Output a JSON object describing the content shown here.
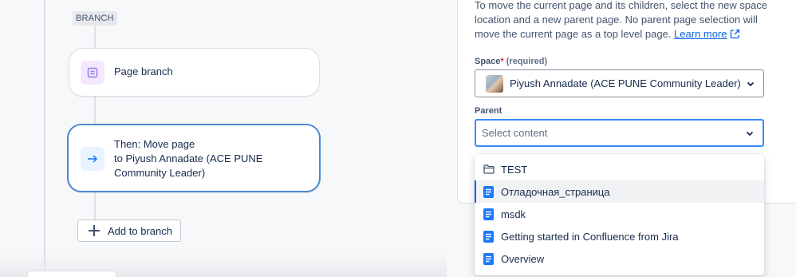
{
  "canvas": {
    "branch_tag": "BRANCH",
    "page_branch_label": "Page branch",
    "move_node": {
      "line1": "Then: Move page",
      "line2": "to Piyush Annadate (ACE PUNE",
      "line3": "Community Leader)"
    },
    "add_branch_label": "Add to branch"
  },
  "panel": {
    "description": "To move the current page and its children, select the new space location and a new parent page. No parent page selection will move the current page as a top level page.",
    "learn_more": "Learn more",
    "space_label": "Space",
    "space_required_mark": "*",
    "space_required_hint": "(required)",
    "space_value": "Piyush Annadate (ACE PUNE Community Leader)",
    "parent_label": "Parent",
    "parent_placeholder": "Select content"
  },
  "dropdown": {
    "options": [
      {
        "label": "TEST",
        "icon": "folder-icon"
      },
      {
        "label": "Отладочная_страница",
        "icon": "page-icon",
        "selected": true
      },
      {
        "label": "msdk",
        "icon": "page-icon"
      },
      {
        "label": "Getting started in Confluence from Jira",
        "icon": "page-icon"
      },
      {
        "label": "Overview",
        "icon": "page-icon"
      }
    ]
  },
  "colors": {
    "accent": "#0c66e4",
    "focus_border": "#388bff",
    "page_icon": "#1d7afc",
    "branch_icon_bg": "#f3e8fd",
    "branch_icon": "#8f7ee7"
  }
}
